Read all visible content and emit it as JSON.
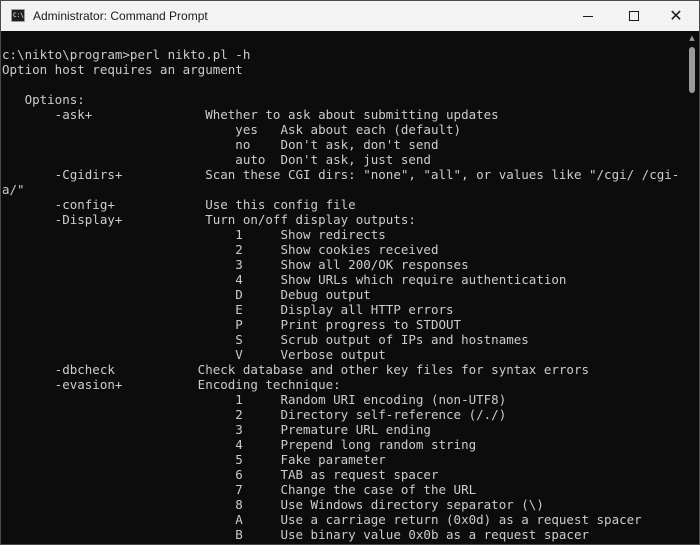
{
  "window": {
    "title": "Administrator: Command Prompt",
    "app_icon_text": "C:\\",
    "app_icon": "terminal-icon",
    "controls": {
      "minimize": "minimize-icon",
      "maximize": "maximize-icon",
      "close": "close-icon",
      "close_glyph": "✕"
    }
  },
  "scrollbar": {
    "up_glyph": "▲"
  },
  "console": {
    "lines": [
      "c:\\nikto\\program>perl nikto.pl -h",
      "Option host requires an argument",
      "",
      "   Options:",
      "       -ask+               Whether to ask about submitting updates",
      "                               yes   Ask about each (default)",
      "                               no    Don't ask, don't send",
      "                               auto  Don't ask, just send",
      "       -Cgidirs+           Scan these CGI dirs: \"none\", \"all\", or values like \"/cgi/ /cgi-",
      "a/\"",
      "       -config+            Use this config file",
      "       -Display+           Turn on/off display outputs:",
      "                               1     Show redirects",
      "                               2     Show cookies received",
      "                               3     Show all 200/OK responses",
      "                               4     Show URLs which require authentication",
      "                               D     Debug output",
      "                               E     Display all HTTP errors",
      "                               P     Print progress to STDOUT",
      "                               S     Scrub output of IPs and hostnames",
      "                               V     Verbose output",
      "       -dbcheck           Check database and other key files for syntax errors",
      "       -evasion+          Encoding technique:",
      "                               1     Random URI encoding (non-UTF8)",
      "                               2     Directory self-reference (/./)",
      "                               3     Premature URL ending",
      "                               4     Prepend long random string",
      "                               5     Fake parameter",
      "                               6     TAB as request spacer",
      "                               7     Change the case of the URL",
      "                               8     Use Windows directory separator (\\)",
      "                               A     Use a carriage return (0x0d) as a request spacer",
      "                               B     Use binary value 0x0b as a request spacer"
    ]
  }
}
